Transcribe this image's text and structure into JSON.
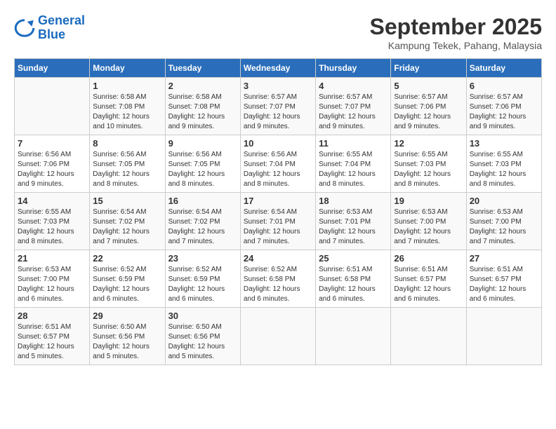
{
  "logo": {
    "line1": "General",
    "line2": "Blue"
  },
  "title": "September 2025",
  "location": "Kampung Tekek, Pahang, Malaysia",
  "weekdays": [
    "Sunday",
    "Monday",
    "Tuesday",
    "Wednesday",
    "Thursday",
    "Friday",
    "Saturday"
  ],
  "weeks": [
    [
      {
        "day": "",
        "sunrise": "",
        "sunset": "",
        "daylight": ""
      },
      {
        "day": "1",
        "sunrise": "Sunrise: 6:58 AM",
        "sunset": "Sunset: 7:08 PM",
        "daylight": "Daylight: 12 hours and 10 minutes."
      },
      {
        "day": "2",
        "sunrise": "Sunrise: 6:58 AM",
        "sunset": "Sunset: 7:08 PM",
        "daylight": "Daylight: 12 hours and 9 minutes."
      },
      {
        "day": "3",
        "sunrise": "Sunrise: 6:57 AM",
        "sunset": "Sunset: 7:07 PM",
        "daylight": "Daylight: 12 hours and 9 minutes."
      },
      {
        "day": "4",
        "sunrise": "Sunrise: 6:57 AM",
        "sunset": "Sunset: 7:07 PM",
        "daylight": "Daylight: 12 hours and 9 minutes."
      },
      {
        "day": "5",
        "sunrise": "Sunrise: 6:57 AM",
        "sunset": "Sunset: 7:06 PM",
        "daylight": "Daylight: 12 hours and 9 minutes."
      },
      {
        "day": "6",
        "sunrise": "Sunrise: 6:57 AM",
        "sunset": "Sunset: 7:06 PM",
        "daylight": "Daylight: 12 hours and 9 minutes."
      }
    ],
    [
      {
        "day": "7",
        "sunrise": "Sunrise: 6:56 AM",
        "sunset": "Sunset: 7:06 PM",
        "daylight": "Daylight: 12 hours and 9 minutes."
      },
      {
        "day": "8",
        "sunrise": "Sunrise: 6:56 AM",
        "sunset": "Sunset: 7:05 PM",
        "daylight": "Daylight: 12 hours and 8 minutes."
      },
      {
        "day": "9",
        "sunrise": "Sunrise: 6:56 AM",
        "sunset": "Sunset: 7:05 PM",
        "daylight": "Daylight: 12 hours and 8 minutes."
      },
      {
        "day": "10",
        "sunrise": "Sunrise: 6:56 AM",
        "sunset": "Sunset: 7:04 PM",
        "daylight": "Daylight: 12 hours and 8 minutes."
      },
      {
        "day": "11",
        "sunrise": "Sunrise: 6:55 AM",
        "sunset": "Sunset: 7:04 PM",
        "daylight": "Daylight: 12 hours and 8 minutes."
      },
      {
        "day": "12",
        "sunrise": "Sunrise: 6:55 AM",
        "sunset": "Sunset: 7:03 PM",
        "daylight": "Daylight: 12 hours and 8 minutes."
      },
      {
        "day": "13",
        "sunrise": "Sunrise: 6:55 AM",
        "sunset": "Sunset: 7:03 PM",
        "daylight": "Daylight: 12 hours and 8 minutes."
      }
    ],
    [
      {
        "day": "14",
        "sunrise": "Sunrise: 6:55 AM",
        "sunset": "Sunset: 7:03 PM",
        "daylight": "Daylight: 12 hours and 8 minutes."
      },
      {
        "day": "15",
        "sunrise": "Sunrise: 6:54 AM",
        "sunset": "Sunset: 7:02 PM",
        "daylight": "Daylight: 12 hours and 7 minutes."
      },
      {
        "day": "16",
        "sunrise": "Sunrise: 6:54 AM",
        "sunset": "Sunset: 7:02 PM",
        "daylight": "Daylight: 12 hours and 7 minutes."
      },
      {
        "day": "17",
        "sunrise": "Sunrise: 6:54 AM",
        "sunset": "Sunset: 7:01 PM",
        "daylight": "Daylight: 12 hours and 7 minutes."
      },
      {
        "day": "18",
        "sunrise": "Sunrise: 6:53 AM",
        "sunset": "Sunset: 7:01 PM",
        "daylight": "Daylight: 12 hours and 7 minutes."
      },
      {
        "day": "19",
        "sunrise": "Sunrise: 6:53 AM",
        "sunset": "Sunset: 7:00 PM",
        "daylight": "Daylight: 12 hours and 7 minutes."
      },
      {
        "day": "20",
        "sunrise": "Sunrise: 6:53 AM",
        "sunset": "Sunset: 7:00 PM",
        "daylight": "Daylight: 12 hours and 7 minutes."
      }
    ],
    [
      {
        "day": "21",
        "sunrise": "Sunrise: 6:53 AM",
        "sunset": "Sunset: 7:00 PM",
        "daylight": "Daylight: 12 hours and 6 minutes."
      },
      {
        "day": "22",
        "sunrise": "Sunrise: 6:52 AM",
        "sunset": "Sunset: 6:59 PM",
        "daylight": "Daylight: 12 hours and 6 minutes."
      },
      {
        "day": "23",
        "sunrise": "Sunrise: 6:52 AM",
        "sunset": "Sunset: 6:59 PM",
        "daylight": "Daylight: 12 hours and 6 minutes."
      },
      {
        "day": "24",
        "sunrise": "Sunrise: 6:52 AM",
        "sunset": "Sunset: 6:58 PM",
        "daylight": "Daylight: 12 hours and 6 minutes."
      },
      {
        "day": "25",
        "sunrise": "Sunrise: 6:51 AM",
        "sunset": "Sunset: 6:58 PM",
        "daylight": "Daylight: 12 hours and 6 minutes."
      },
      {
        "day": "26",
        "sunrise": "Sunrise: 6:51 AM",
        "sunset": "Sunset: 6:57 PM",
        "daylight": "Daylight: 12 hours and 6 minutes."
      },
      {
        "day": "27",
        "sunrise": "Sunrise: 6:51 AM",
        "sunset": "Sunset: 6:57 PM",
        "daylight": "Daylight: 12 hours and 6 minutes."
      }
    ],
    [
      {
        "day": "28",
        "sunrise": "Sunrise: 6:51 AM",
        "sunset": "Sunset: 6:57 PM",
        "daylight": "Daylight: 12 hours and 5 minutes."
      },
      {
        "day": "29",
        "sunrise": "Sunrise: 6:50 AM",
        "sunset": "Sunset: 6:56 PM",
        "daylight": "Daylight: 12 hours and 5 minutes."
      },
      {
        "day": "30",
        "sunrise": "Sunrise: 6:50 AM",
        "sunset": "Sunset: 6:56 PM",
        "daylight": "Daylight: 12 hours and 5 minutes."
      },
      {
        "day": "",
        "sunrise": "",
        "sunset": "",
        "daylight": ""
      },
      {
        "day": "",
        "sunrise": "",
        "sunset": "",
        "daylight": ""
      },
      {
        "day": "",
        "sunrise": "",
        "sunset": "",
        "daylight": ""
      },
      {
        "day": "",
        "sunrise": "",
        "sunset": "",
        "daylight": ""
      }
    ]
  ]
}
